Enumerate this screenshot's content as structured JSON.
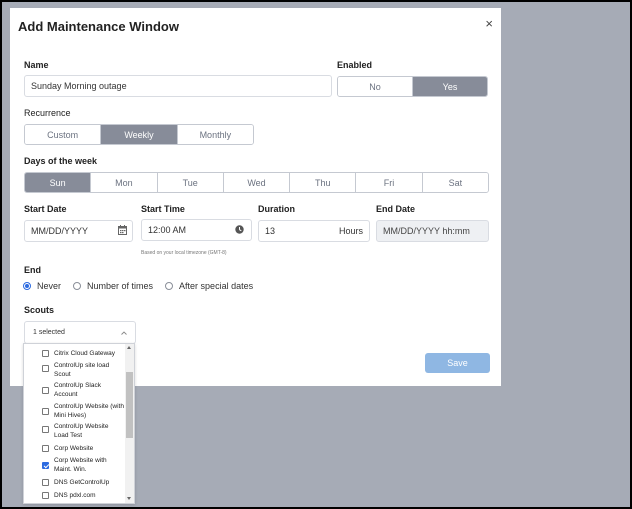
{
  "modal": {
    "title": "Add Maintenance Window",
    "close_label": "×"
  },
  "name": {
    "label": "Name",
    "value": "Sunday Morning outage"
  },
  "enabled": {
    "label": "Enabled",
    "options": [
      "No",
      "Yes"
    ],
    "selected": "Yes"
  },
  "recurrence": {
    "label": "Recurrence",
    "options": [
      "Custom",
      "Weekly",
      "Monthly"
    ],
    "selected": "Weekly"
  },
  "days": {
    "label": "Days of the week",
    "options": [
      "Sun",
      "Mon",
      "Tue",
      "Wed",
      "Thu",
      "Fri",
      "Sat"
    ],
    "selected": "Sun"
  },
  "start_date": {
    "label": "Start Date",
    "placeholder": "MM/DD/YYYY"
  },
  "start_time": {
    "label": "Start Time",
    "value": "12:00 AM",
    "note": "Based on your local timezone (GMT-8)"
  },
  "duration": {
    "label": "Duration",
    "value": "13",
    "unit": "Hours"
  },
  "end_date": {
    "label": "End Date",
    "value": "MM/DD/YYYY hh:mm"
  },
  "end": {
    "label": "End",
    "options": [
      "Never",
      "Number of times",
      "After special dates"
    ],
    "selected": "Never"
  },
  "scouts": {
    "label": "Scouts",
    "selected_summary": "1 selected",
    "items": [
      {
        "label": "Citrix Cloud Gateway",
        "checked": false
      },
      {
        "label": "ControlUp site load Scout",
        "checked": false
      },
      {
        "label": "ControlUp Slack Account",
        "checked": false
      },
      {
        "label": "ControlUp Website (with Mini Hives)",
        "checked": false
      },
      {
        "label": "ControlUp Website Load Test",
        "checked": false
      },
      {
        "label": "Corp Website",
        "checked": false
      },
      {
        "label": "Corp Website with Maint. Win.",
        "checked": true
      },
      {
        "label": "DNS GetControlUp",
        "checked": false
      },
      {
        "label": "DNS pdxl.com",
        "checked": false
      }
    ]
  },
  "save_label": "Save",
  "icons": {
    "calendar": "calendar-icon",
    "clock": "clock-icon",
    "chevron": "chevron-up-icon"
  },
  "colors": {
    "segment_active": "#878c99",
    "save_button": "#8fb7e3",
    "checkbox_accent": "#2d6be0",
    "backdrop": "#a6abb6"
  }
}
